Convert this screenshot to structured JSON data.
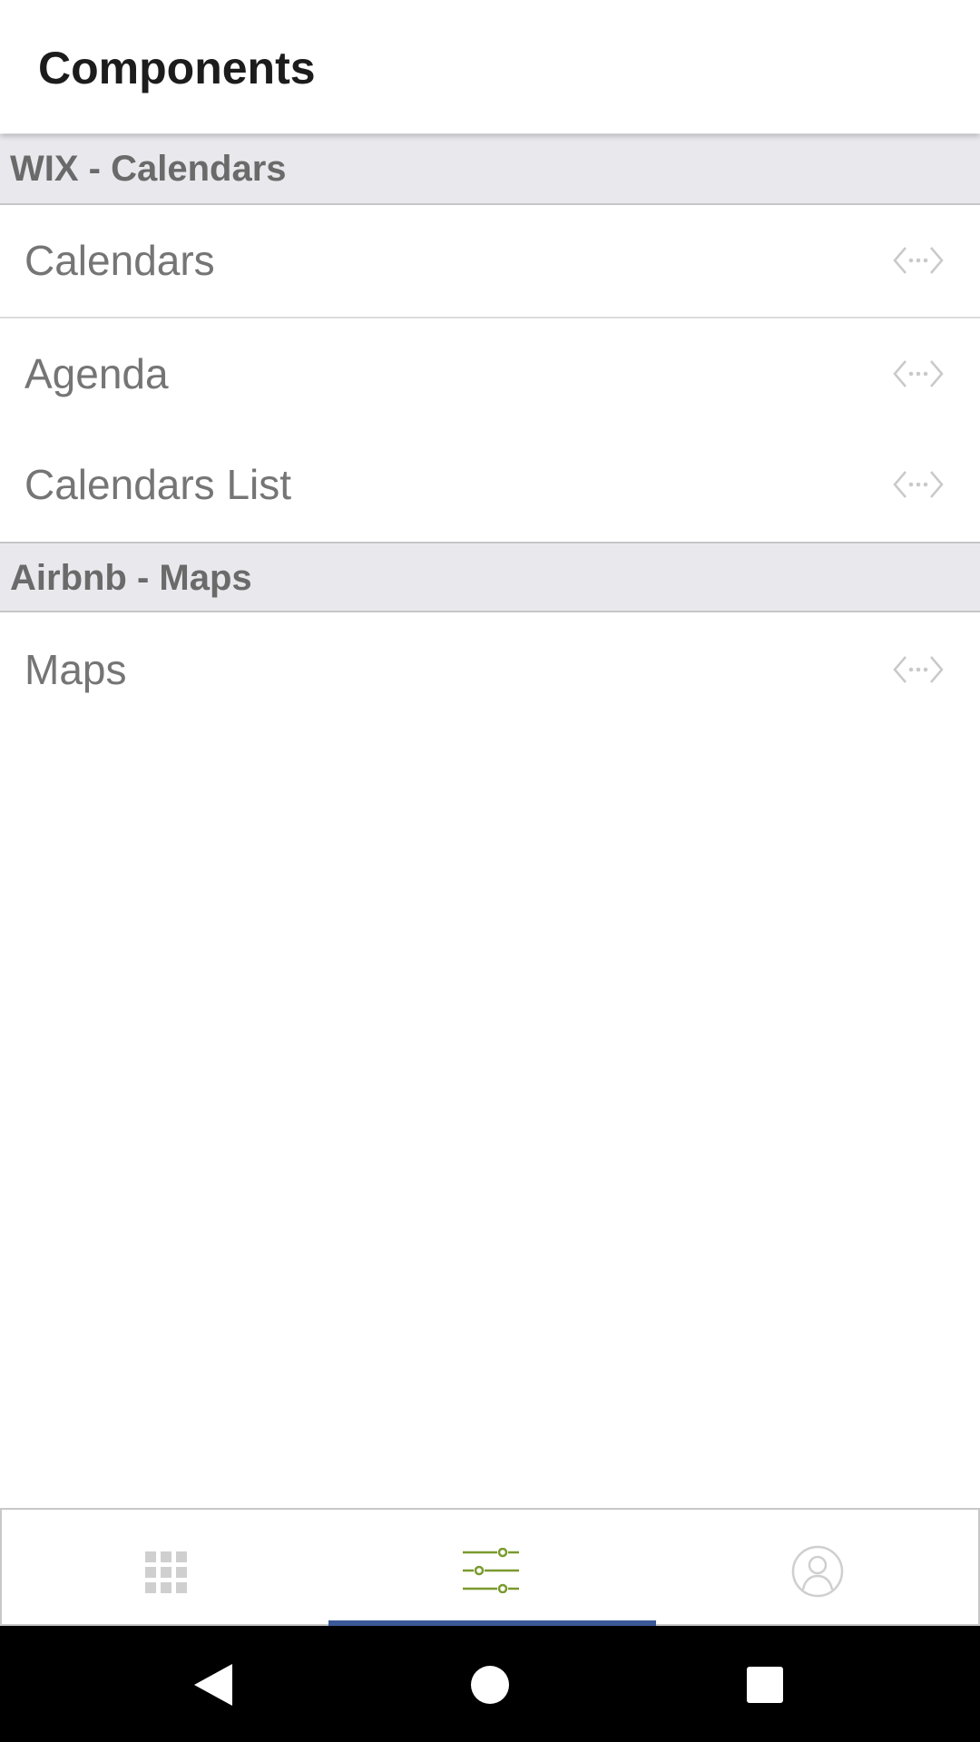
{
  "header": {
    "title": "Components"
  },
  "sections": [
    {
      "label": "WIX - Calendars",
      "items": [
        {
          "label": "Calendars",
          "icon": "code-icon"
        },
        {
          "label": "Agenda",
          "icon": "code-icon"
        },
        {
          "label": "Calendars List",
          "icon": "code-icon"
        }
      ]
    },
    {
      "label": "Airbnb - Maps",
      "items": [
        {
          "label": "Maps",
          "icon": "code-icon"
        }
      ]
    }
  ],
  "tabbar": {
    "tabs": [
      {
        "icon": "grid-icon",
        "selected": false
      },
      {
        "icon": "sliders-icon",
        "selected": true
      },
      {
        "icon": "user-icon",
        "selected": false
      }
    ],
    "colors": {
      "selected_icon": "#7a9a2e",
      "unselected_icon": "#cfcfcf",
      "indicator": "#3b5998"
    }
  },
  "navbar": {
    "buttons": [
      "back-icon",
      "home-icon",
      "recents-icon"
    ]
  }
}
